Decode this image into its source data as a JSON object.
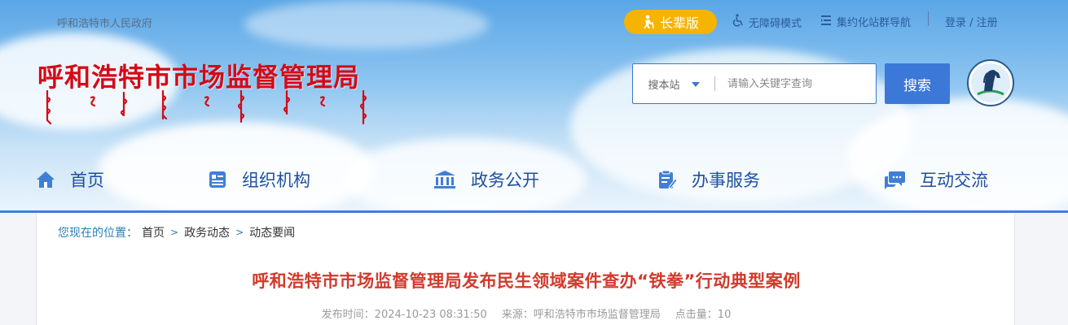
{
  "header": {
    "gov_link": "呼和浩特市人民政府",
    "senior_mode": "长辈版",
    "accessibility": "无障碍模式",
    "site_nav": "集约化站群导航",
    "login": "登录 / 注册",
    "site_title": "呼和浩特市市场监督管理局"
  },
  "search": {
    "scope": "搜本站",
    "placeholder": "请输入关键字查询",
    "button": "搜索"
  },
  "nav": {
    "items": [
      {
        "label": "首页",
        "icon": "home-icon"
      },
      {
        "label": "组织机构",
        "icon": "org-icon"
      },
      {
        "label": "政务公开",
        "icon": "gov-building-icon"
      },
      {
        "label": "办事服务",
        "icon": "service-form-icon"
      },
      {
        "label": "互动交流",
        "icon": "chat-icon"
      }
    ]
  },
  "breadcrumb": {
    "prefix": "您现在的位置：",
    "items": [
      "首页",
      "政务动态",
      "动态要闻"
    ],
    "separator": ">"
  },
  "article": {
    "title": "呼和浩特市市场监督管理局发布民生领域案件查办“铁拳”行动典型案例",
    "publish_label": "发布时间：",
    "publish_time": "2024-10-23 08:31:50",
    "source_label": "来源：",
    "source": "呼和浩特市市场监督管理局",
    "views_label": "点击量：",
    "views": "10"
  },
  "colors": {
    "title_red": "#d40a17",
    "nav_blue": "#1e50a0",
    "accent_blue": "#3b78d8",
    "senior_yellow": "#f5b400"
  }
}
